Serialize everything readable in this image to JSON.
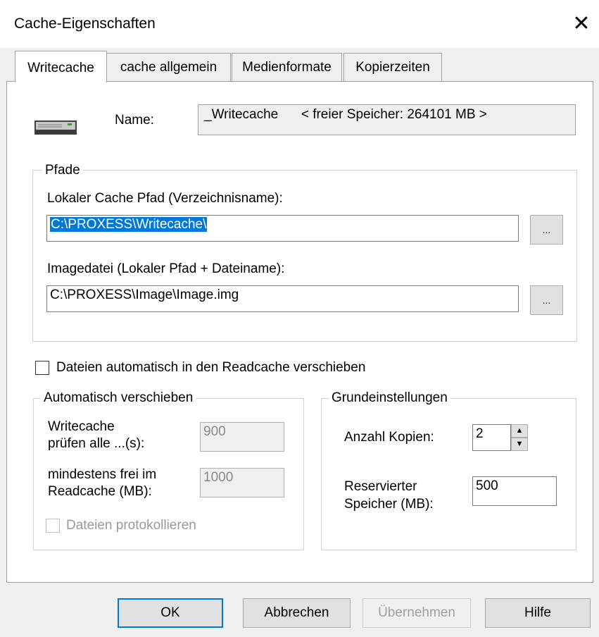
{
  "window": {
    "title": "Cache-Eigenschaften",
    "close_glyph": "✕"
  },
  "tabs": [
    {
      "label": "Writecache"
    },
    {
      "label": "cache allgemein"
    },
    {
      "label": "Medienformate"
    },
    {
      "label": "Kopierzeiten"
    }
  ],
  "cache": {
    "icon": "drive-icon",
    "name_label": "Name:",
    "name_value": "_Writecache",
    "free_memory": "< freier Speicher:  264101 MB >"
  },
  "paths": {
    "group_label": "Pfade",
    "local_cache_label": "Lokaler Cache Pfad (Verzeichnisname):",
    "local_cache_value": "C:\\PROXESS\\Writecache\\",
    "image_file_label": "Imagedatei (Lokaler Pfad + Dateiname):",
    "image_file_value": "C:\\PROXESS\\Image\\Image.img",
    "browse_label": "..."
  },
  "auto_move_checkbox": {
    "label": "Dateien automatisch in den Readcache verschieben",
    "checked": false
  },
  "auto_move": {
    "group_label": "Automatisch verschieben",
    "check_every_line1": "Writecache",
    "check_every_line2": "prüfen alle ...(s):",
    "check_every_value": "900",
    "min_free_line1": "mindestens frei im",
    "min_free_line2": "Readcache (MB):",
    "min_free_value": "1000",
    "log_files_label": "Dateien protokollieren"
  },
  "basic": {
    "group_label": "Grundeinstellungen",
    "copies_label": "Anzahl Kopien:",
    "copies_value": "2",
    "reserved_line1": "Reservierter",
    "reserved_line2": "Speicher (MB):",
    "reserved_value": "500"
  },
  "buttons": {
    "ok": "OK",
    "cancel": "Abbrechen",
    "apply": "Übernehmen",
    "help": "Hilfe"
  }
}
